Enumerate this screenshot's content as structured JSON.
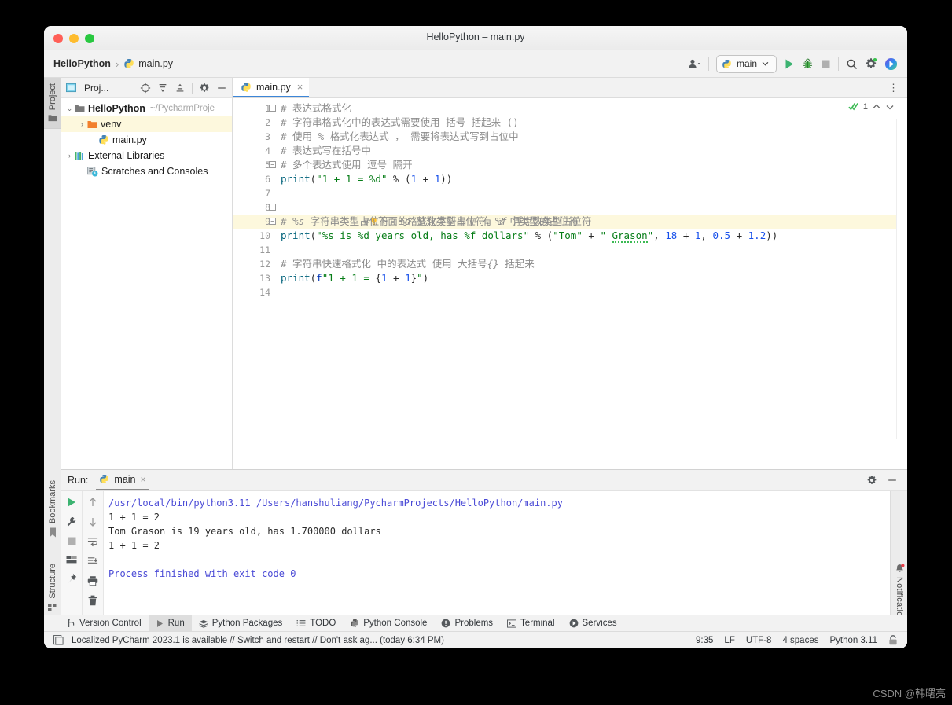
{
  "window": {
    "title": "HelloPython – main.py",
    "traffic": {
      "close": "close-button",
      "minimize": "minimize-button",
      "maximize": "maximize-button"
    }
  },
  "breadcrumb": {
    "project": "HelloPython",
    "separator": "›",
    "file": "main.py"
  },
  "toolbar": {
    "account_icon": "account-icon",
    "run_config": "main",
    "run_label": "run-button",
    "debug_label": "debug-button",
    "stop_label": "stop-button",
    "search_label": "search-button",
    "settings_label": "settings-button",
    "assistant_label": "ai-assistant-button"
  },
  "rails": {
    "project": "Project",
    "bookmarks": "Bookmarks",
    "structure": "Structure",
    "notifications": "Notifications"
  },
  "project_panel": {
    "title": "Proj...",
    "tree": [
      {
        "label": "HelloPython",
        "path": "~/PycharmProje",
        "arrow": "⌄",
        "bold": true,
        "indent": 0,
        "icon": "folder-icon",
        "selected": false
      },
      {
        "label": "venv",
        "path": "",
        "arrow": "›",
        "bold": false,
        "indent": 1,
        "icon": "folder-orange-icon",
        "selected": true
      },
      {
        "label": "main.py",
        "path": "",
        "arrow": "",
        "bold": false,
        "indent": 2,
        "icon": "python-file-icon",
        "selected": false
      },
      {
        "label": "External Libraries",
        "path": "",
        "arrow": "›",
        "bold": false,
        "indent": 0,
        "icon": "library-icon",
        "selected": false
      },
      {
        "label": "Scratches and Consoles",
        "path": "",
        "arrow": "",
        "bold": false,
        "indent": 1,
        "icon": "scratches-icon",
        "selected": false
      }
    ]
  },
  "editor": {
    "tab": "main.py",
    "tab_close": "×",
    "inspection_count": "1",
    "lines": [
      1,
      2,
      3,
      4,
      5,
      6,
      7,
      8,
      9,
      10,
      11,
      12,
      13,
      14
    ],
    "highlight_line": 9,
    "code": [
      "# 表达式格式化",
      "# 字符串格式化中的表达式需要使用 括号 括起来 ()",
      "# 使用 % 格式化表达式 ， 需要将表达式写到占位中",
      "# 表达式写在括号中",
      "# 多个表达式使用 逗号 隔开",
      "print(\"1 + 1 = %d\" % (1 + 1))",
      "",
      "# 下面的格式化字符串中 有 3 中类型的占位符",
      "# %s 字符串类型占位符，%d 整数类型占位符，%f 浮点数类型占位符",
      "print(\"%s is %d years old, has %f dollars\" % (\"Tom\" + \" Grason\", 18 + 1, 0.5 + 1.2))",
      "",
      "# 字符串快速格式化 中的表达式 使用 大括号{} 括起来",
      "print(f\"1 + 1 = {1 + 1}\")",
      ""
    ]
  },
  "run_panel": {
    "label": "Run:",
    "tab": "main",
    "tab_close": "×",
    "settings_icon": "gear-icon",
    "minimize_icon": "minimize-icon",
    "left_tools": [
      "rerun-icon",
      "wrench-icon",
      "stop-icon",
      "layout-icon",
      "pin-icon"
    ],
    "right_tools": [
      "arrow-up-icon",
      "arrow-down-icon",
      "soft-wrap-icon",
      "scroll-end-icon",
      "print-icon",
      "trash-icon"
    ],
    "output": [
      {
        "text": "/usr/local/bin/python3.11 /Users/hanshuliang/PycharmProjects/HelloPython/main.py",
        "style": "path"
      },
      {
        "text": "1 + 1 = 2",
        "style": ""
      },
      {
        "text": "Tom Grason is 19 years old, has 1.700000 dollars",
        "style": ""
      },
      {
        "text": "1 + 1 = 2",
        "style": ""
      },
      {
        "text": "",
        "style": ""
      },
      {
        "text": "Process finished with exit code 0",
        "style": "fin"
      }
    ]
  },
  "tool_tabs": [
    {
      "label": "Version Control",
      "icon": "branch-icon",
      "active": false
    },
    {
      "label": "Run",
      "icon": "play-icon",
      "active": true
    },
    {
      "label": "Python Packages",
      "icon": "packages-icon",
      "active": false
    },
    {
      "label": "TODO",
      "icon": "todo-icon",
      "active": false
    },
    {
      "label": "Python Console",
      "icon": "python-icon",
      "active": false
    },
    {
      "label": "Problems",
      "icon": "problems-icon",
      "active": false
    },
    {
      "label": "Terminal",
      "icon": "terminal-icon",
      "active": false
    },
    {
      "label": "Services",
      "icon": "services-icon",
      "active": false
    }
  ],
  "status_bar": {
    "message": "Localized PyCharm 2023.1 is available // Switch and restart // Don't ask ag... (today 6:34 PM)",
    "caret": "9:35",
    "line_sep": "LF",
    "encoding": "UTF-8",
    "indent": "4 spaces",
    "interpreter": "Python 3.11",
    "lock_icon": "lock-icon"
  },
  "watermark": "CSDN @韩曙亮",
  "colors": {
    "accent": "#3c86d8",
    "green": "#3cba54",
    "highlight": "#fdf8dd",
    "string": "#067d17",
    "keyword": "#0033b3",
    "number": "#1750eb",
    "comment": "#8c8c8c"
  }
}
